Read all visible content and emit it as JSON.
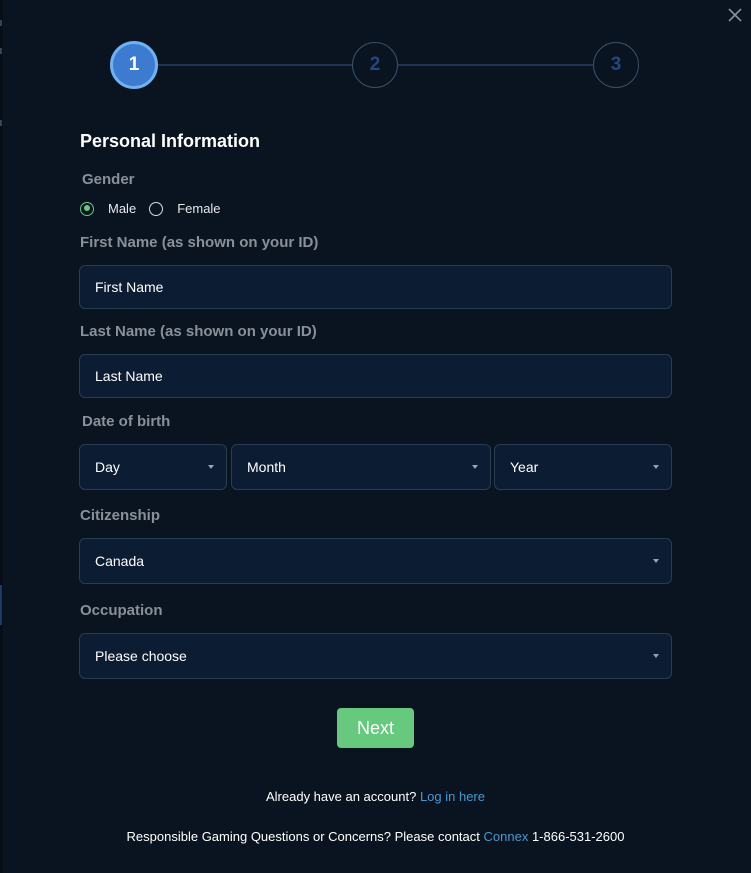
{
  "stepper": {
    "steps": [
      {
        "label": "1",
        "state": "active"
      },
      {
        "label": "2",
        "state": "inactive"
      },
      {
        "label": "3",
        "state": "inactive"
      }
    ]
  },
  "form": {
    "title": "Personal Information",
    "gender": {
      "label": "Gender",
      "options": [
        {
          "label": "Male",
          "checked": true
        },
        {
          "label": "Female",
          "checked": false
        }
      ]
    },
    "first_name": {
      "label": "First Name (as shown on your ID)",
      "placeholder": "First Name"
    },
    "last_name": {
      "label": "Last Name (as shown on your ID)",
      "placeholder": "Last Name"
    },
    "dob": {
      "label": "Date of birth",
      "day": "Day",
      "month": "Month",
      "year": "Year"
    },
    "citizenship": {
      "label": "Citizenship",
      "value": "Canada"
    },
    "occupation": {
      "label": "Occupation",
      "value": "Please choose"
    },
    "next_label": "Next"
  },
  "footer": {
    "account_text": "Already have an account?",
    "login_link": "Log in here",
    "rg_text": "Responsible Gaming Questions or Concerns? Please contact",
    "rg_link": "Connex",
    "phone": "1-866-531-2600"
  },
  "colors": {
    "background": "#0a1420",
    "accent_blue": "#3d7bd1",
    "button_green": "#66c97d",
    "link": "#4a97d0"
  }
}
